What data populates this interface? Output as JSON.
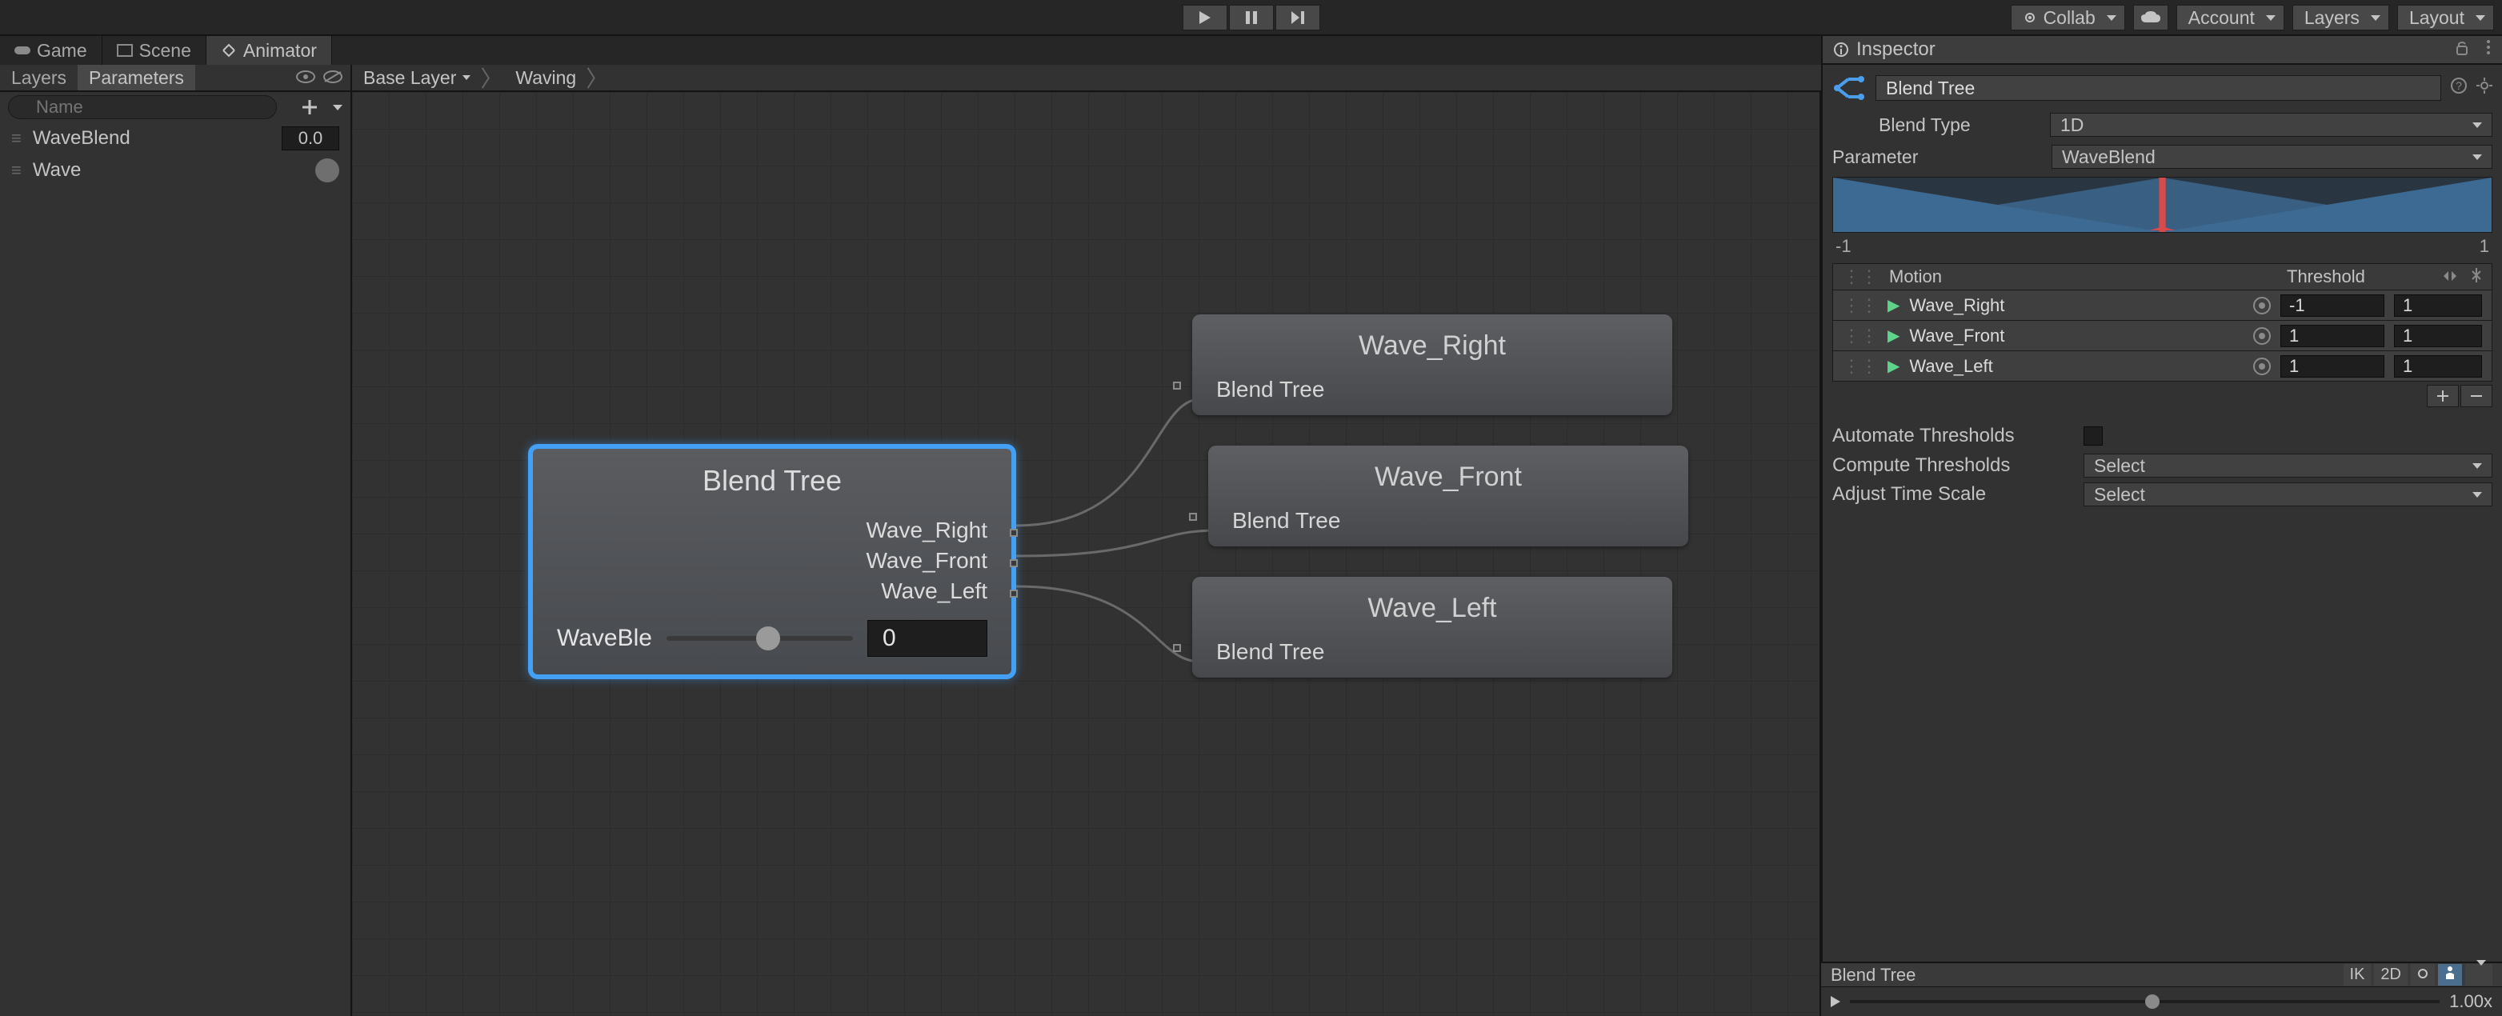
{
  "topbar": {
    "collab": "Collab",
    "account": "Account",
    "layers": "Layers",
    "layout": "Layout"
  },
  "tabs": {
    "game": "Game",
    "scene": "Scene",
    "animator": "Animator"
  },
  "left": {
    "layers_tab": "Layers",
    "parameters_tab": "Parameters",
    "search_placeholder": "Name",
    "params": [
      {
        "name": "WaveBlend",
        "value": "0.0",
        "type": "float"
      },
      {
        "name": "Wave",
        "value": "",
        "type": "bool"
      }
    ]
  },
  "breadcrumb": {
    "base": "Base Layer",
    "state": "Waving"
  },
  "graph": {
    "main": {
      "title": "Blend Tree",
      "outs": [
        "Wave_Right",
        "Wave_Front",
        "Wave_Left"
      ],
      "slider_label": "WaveBle",
      "slider_value": "0"
    },
    "children": [
      {
        "title": "Wave_Right",
        "sub": "Blend Tree"
      },
      {
        "title": "Wave_Front",
        "sub": "Blend Tree"
      },
      {
        "title": "Wave_Left",
        "sub": "Blend Tree"
      }
    ]
  },
  "inspector": {
    "tab": "Inspector",
    "title": "Blend Tree",
    "blend_type_label": "Blend Type",
    "blend_type_value": "1D",
    "parameter_label": "Parameter",
    "parameter_value": "WaveBlend",
    "range_min": "-1",
    "range_max": "1",
    "motion_header": {
      "motion": "Motion",
      "threshold": "Threshold"
    },
    "motions": [
      {
        "name": "Wave_Right",
        "threshold": "-1",
        "timescale": "1"
      },
      {
        "name": "Wave_Front",
        "threshold": "1",
        "timescale": "1"
      },
      {
        "name": "Wave_Left",
        "threshold": "1",
        "timescale": "1"
      }
    ],
    "automate_label": "Automate Thresholds",
    "compute_label": "Compute Thresholds",
    "compute_value": "Select",
    "adjust_label": "Adjust Time Scale",
    "adjust_value": "Select"
  },
  "preview": {
    "title": "Blend Tree",
    "tags": [
      "IK",
      "2D"
    ],
    "speed": "1.00x"
  }
}
